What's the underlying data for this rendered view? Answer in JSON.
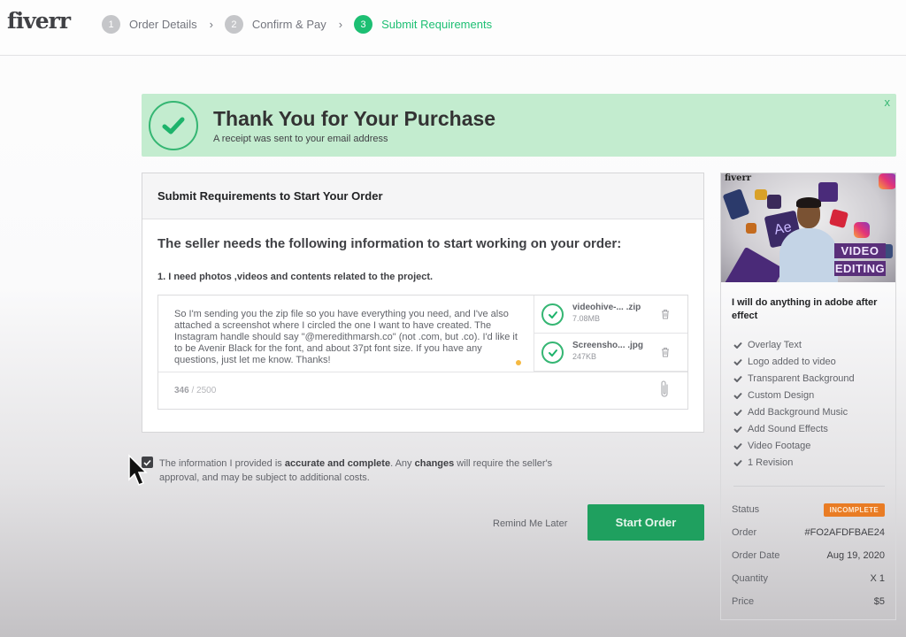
{
  "header": {
    "logo": "fiverr",
    "steps": [
      {
        "num": "1",
        "label": "Order Details",
        "active": false
      },
      {
        "num": "2",
        "label": "Confirm & Pay",
        "active": false
      },
      {
        "num": "3",
        "label": "Submit Requirements",
        "active": true
      }
    ],
    "separator": "›"
  },
  "banner": {
    "icon": "check-circle-icon",
    "title": "Thank You for Your Purchase",
    "subtitle": "A receipt was sent to your email address",
    "close": "x"
  },
  "requirements": {
    "heading": "Submit Requirements to Start Your Order",
    "question": "The seller needs the following information to start working on your order:",
    "item_label": "1. I need  photos ,videos and contents  related to the project.",
    "answer": "So I'm sending you the zip file so you have everything you need, and I've also attached a screenshot where I circled the one I want to have created. The Instagram handle should say \"@meredithmarsh.co\" (not .com, but .co). I'd like it to be Avenir Black for the font, and about 37pt font size.  If you have any questions, just let me know. Thanks!",
    "char_count": "346",
    "char_limit": "/ 2500",
    "files": [
      {
        "name": "videohive-... .zip",
        "size": "7.08MB"
      },
      {
        "name": "Screensho... .jpg",
        "size": "247KB"
      }
    ]
  },
  "agreement": {
    "checked": true,
    "text_1": "The information I provided is ",
    "bold_1": "accurate and complete",
    "text_2": ". Any ",
    "bold_2": "changes",
    "text_3": " will require the seller's approval, and may be subject to additional costs."
  },
  "actions": {
    "remind_label": "Remind Me Later",
    "start_label": "Start Order"
  },
  "sidebar": {
    "thumb_logo": "fiverr",
    "thumb_text_1": "VIDEO",
    "thumb_text_2": "EDITING",
    "thumb_tile_ae": "Ae",
    "gig_title": "I will do anything in adobe after effect",
    "features": [
      "Overlay Text",
      "Logo added to video",
      "Transparent Background",
      "Custom Design",
      "Add Background Music",
      "Add Sound Effects",
      "Video Footage",
      "1 Revision"
    ],
    "meta": {
      "status_label": "Status",
      "status_value": "INCOMPLETE",
      "order_label": "Order",
      "order_value": "#FO2AFDFBAE24",
      "date_label": "Order Date",
      "date_value": "Aug 19, 2020",
      "qty_label": "Quantity",
      "qty_value": "X 1",
      "price_label": "Price",
      "price_value": "$5"
    }
  },
  "colors": {
    "brand_green": "#1dbf73",
    "button_green": "#1fa05f",
    "banner_bg": "#c3eccf",
    "status_orange": "#e97c24"
  }
}
